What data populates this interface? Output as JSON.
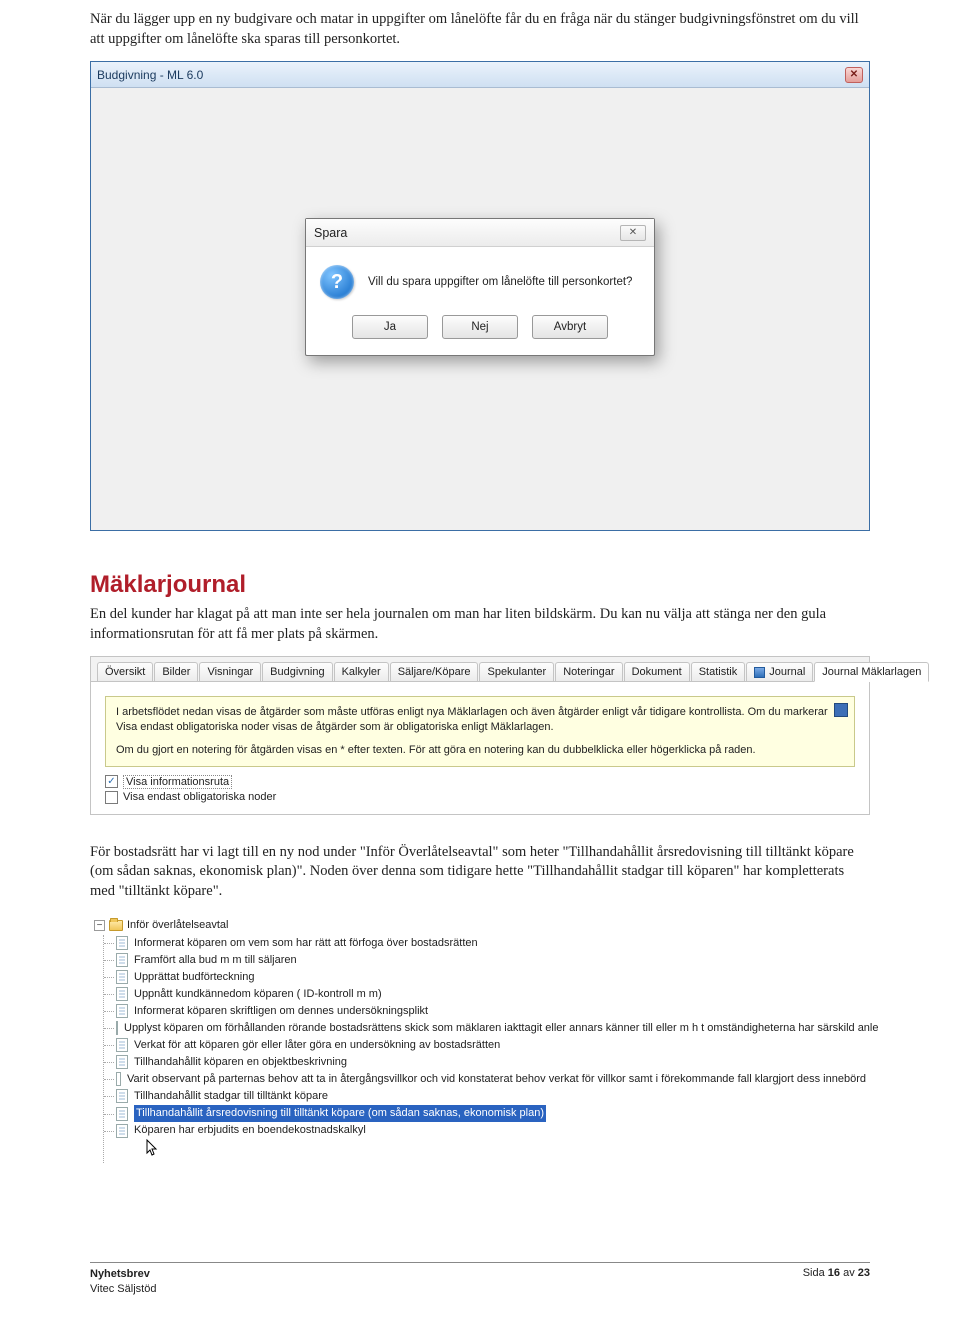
{
  "intro": "När du lägger upp en ny budgivare och matar in uppgifter om lånelöfte får du en fråga när du stänger budgivningsfönstret om du vill att uppgifter om lånelöfte ska sparas till personkortet.",
  "budgivning_window": {
    "title": "Budgivning - ML 6.0"
  },
  "save_dialog": {
    "title": "Spara",
    "message": "Vill du spara uppgifter om lånelöfte till personkortet?",
    "buttons": {
      "yes": "Ja",
      "no": "Nej",
      "cancel": "Avbryt"
    }
  },
  "section_heading": "Mäklarjournal",
  "section_body": "En del kunder har klagat på att man inte ser hela journalen om man har liten bildskärm. Du kan nu välja att stänga ner den gula informationsrutan för att få mer plats på skärmen.",
  "tabs": [
    "Översikt",
    "Bilder",
    "Visningar",
    "Budgivning",
    "Kalkyler",
    "Säljare/Köpare",
    "Spekulanter",
    "Noteringar",
    "Dokument",
    "Statistik",
    "Journal",
    "Journal Mäklarlagen"
  ],
  "yellow_info": {
    "p1": "I arbetsflödet nedan visas de åtgärder som måste utföras enligt nya Mäklarlagen och även åtgärder enligt vår tidigare kontrollista. Om du markerar Visa endast obligatoriska noder visas de åtgärder som är obligatoriska enligt Mäklarlagen.",
    "p2": "Om du gjort en notering för åtgärden visas en * efter texten. För att göra en notering kan du dubbelklicka eller högerklicka på raden."
  },
  "checks": {
    "c1": "Visa informationsruta",
    "c2": "Visa endast obligatoriska noder"
  },
  "para2": "För bostadsrätt har vi lagt till en ny nod under \"Inför Överlåtelseavtal\" som heter \"Tillhandahållit årsredovisning till tilltänkt köpare (om sådan saknas, ekonomisk plan)\". Noden över denna som tidigare hette \"Tillhandahållit stadgar till köparen\" har kompletterats med \"tilltänkt köpare\".",
  "tree": {
    "root": "Inför överlåtelseavtal",
    "items": [
      "Informerat köparen om vem som har rätt att förfoga över bostadsrätten",
      "Framfört alla bud m m till säljaren",
      "Upprättat budförteckning",
      "Uppnått kundkännedom köparen ( ID-kontroll m m)",
      "Informerat köparen skriftligen om dennes undersökningsplikt",
      "Upplyst köparen om förhållanden rörande bostadsrättens skick som mäklaren iakttagit eller annars känner till eller m h t omständigheterna har särskild anle",
      "Verkat för att köparen gör eller låter göra en undersökning av bostadsrätten",
      "Tillhandahållit köparen en objektbeskrivning",
      "Varit observant på parternas behov att ta in återgångsvillkor och vid konstaterat behov verkat för villkor samt i förekommande fall klargjort dess innebörd",
      "Tillhandahållit stadgar till tilltänkt köpare",
      "Tillhandahållit årsredovisning till tilltänkt köpare (om sådan saknas, ekonomisk plan)",
      "Köparen har erbjudits en boendekostnadskalkyl"
    ],
    "selected_index": 10
  },
  "footer": {
    "l1": "Nyhetsbrev",
    "l2": "Vitec Säljstöd",
    "r_prefix": "Sida ",
    "r_page": "16",
    "r_mid": " av ",
    "r_total": "23"
  }
}
